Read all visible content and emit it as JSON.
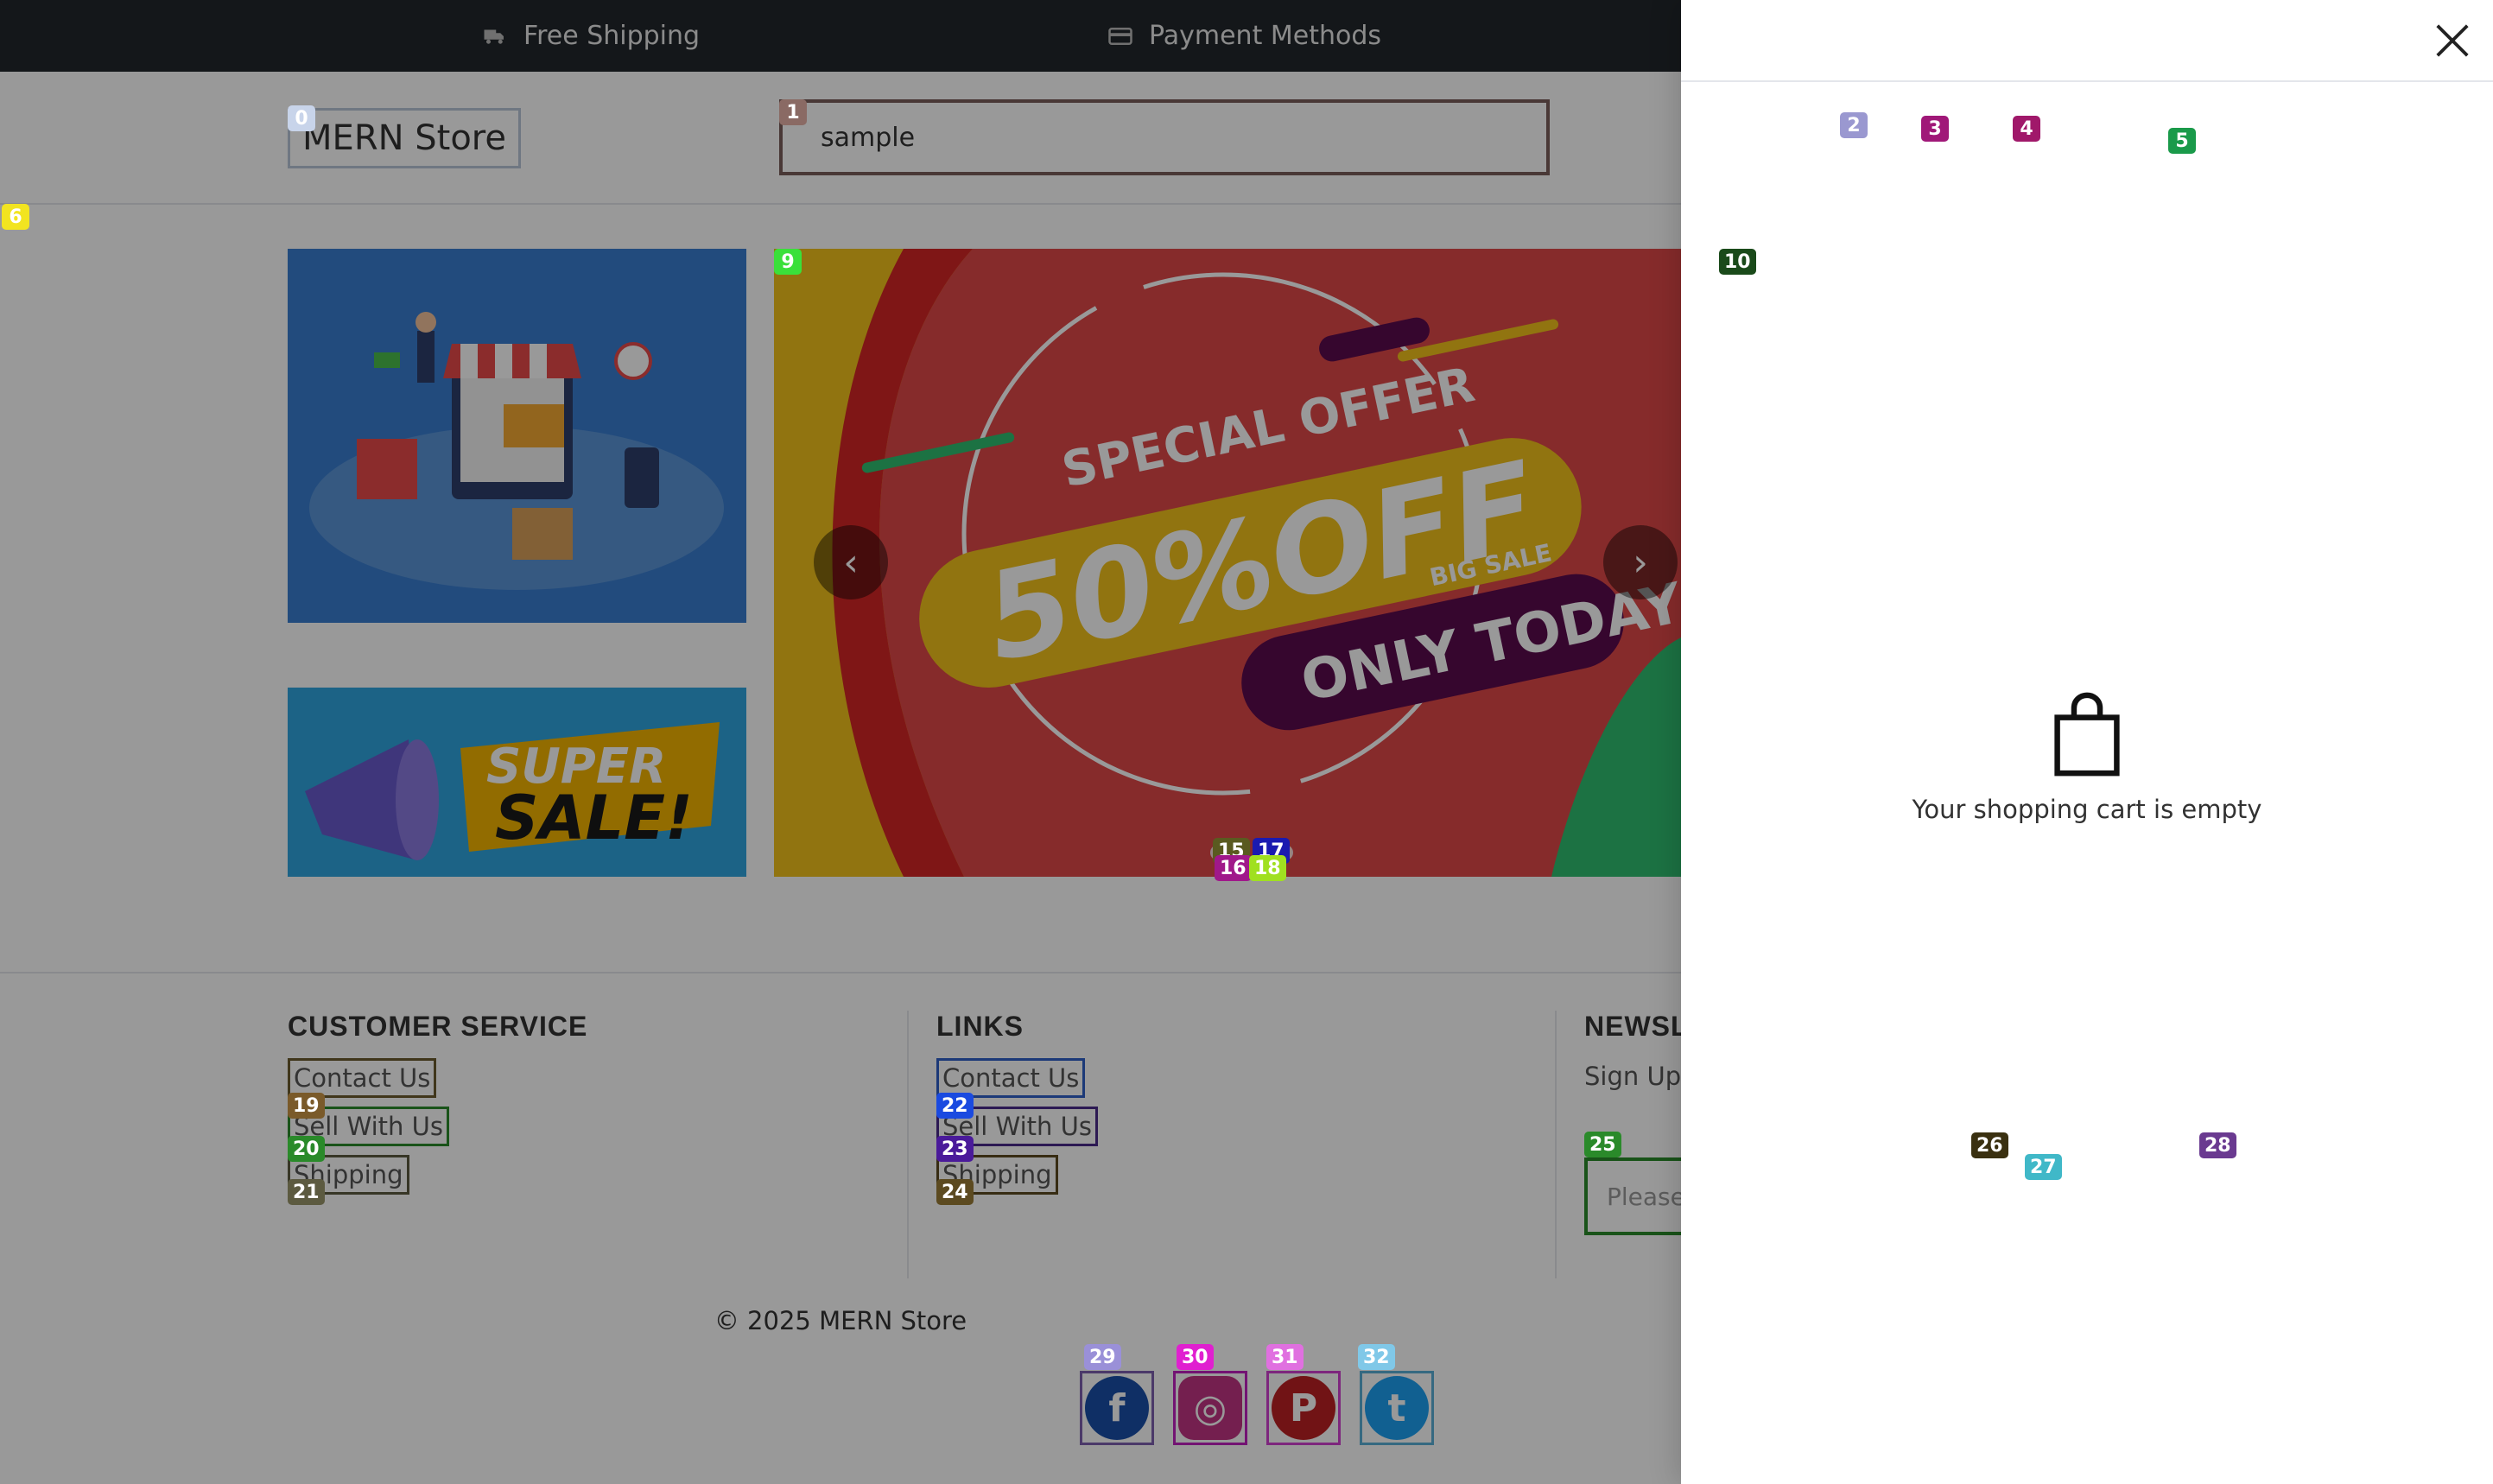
{
  "topbar": {
    "free_shipping": "Free Shipping",
    "payment_methods": "Payment Methods"
  },
  "header": {
    "logo": "MERN Store",
    "search_value": "sample"
  },
  "footer": {
    "customer_service": {
      "title": "CUSTOMER SERVICE",
      "links": [
        "Contact Us",
        "Sell With Us",
        "Shipping"
      ]
    },
    "links": {
      "title": "LINKS",
      "links": [
        "Contact Us",
        "Sell With Us",
        "Shipping"
      ]
    },
    "newsletter": {
      "title": "NEWSL",
      "subtitle": "Sign Up",
      "placeholder": "Please"
    },
    "copyright": "© 2025 MERN Store",
    "social": [
      "facebook-icon",
      "instagram-icon",
      "pinterest-icon",
      "twitter-icon"
    ]
  },
  "banners": {
    "carousel_text": [
      "SPECIAL OFFER",
      "50%OFF",
      "BIG SALE",
      "ONLY TODAY"
    ],
    "sale_text": [
      "SUPER",
      "SALE!"
    ]
  },
  "cart": {
    "empty_message": "Your shopping cart is empty"
  },
  "markers": [
    "0",
    "1",
    "2",
    "3",
    "4",
    "5",
    "6",
    "9",
    "10",
    "15",
    "16",
    "17",
    "18",
    "19",
    "20",
    "21",
    "22",
    "23",
    "24",
    "25",
    "26",
    "27",
    "28",
    "29",
    "30",
    "31",
    "32"
  ],
  "colors": {
    "topbar": "#22272c",
    "overlay": "rgba(0,0,0,0.4)",
    "carousel": "#e04848",
    "facebook": "#1a4fa8",
    "instagram": "#c13584",
    "pinterest": "#bd2124",
    "twitter": "#1da1f2"
  }
}
